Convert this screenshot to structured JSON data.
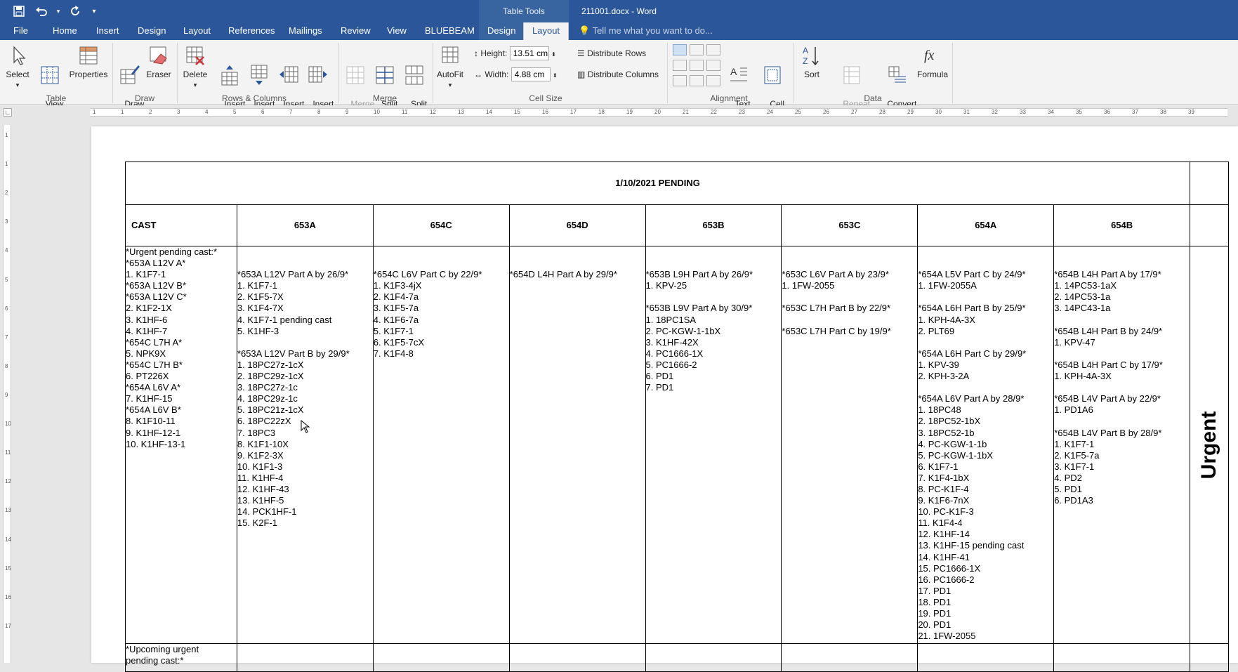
{
  "titlebar": {
    "doc_title": "211001.docx - Word",
    "context_title": "Table Tools",
    "qat": [
      {
        "name": "save-icon",
        "glyph": "💾"
      },
      {
        "name": "undo-icon",
        "glyph": "↶"
      },
      {
        "name": "redo-icon",
        "glyph": "↻"
      },
      {
        "name": "customize-qat-icon",
        "glyph": "▾"
      }
    ]
  },
  "tabs": [
    "File",
    "Home",
    "Insert",
    "Design",
    "Layout",
    "References",
    "Mailings",
    "Review",
    "View",
    "BLUEBEAM",
    "Design",
    "Layout"
  ],
  "tellme": "Tell me what you want to do...",
  "ribbon": {
    "table": {
      "select": "Select",
      "view_gridlines": "View\nGridlines",
      "properties": "Properties",
      "group": "Table"
    },
    "draw": {
      "draw_table": "Draw\nTable",
      "eraser": "Eraser",
      "group": "Draw"
    },
    "rows_columns": {
      "delete": "Delete",
      "insert_above": "Insert\nAbove",
      "insert_below": "Insert\nBelow",
      "insert_left": "Insert\nLeft",
      "insert_right": "Insert\nRight",
      "group": "Rows & Columns"
    },
    "merge": {
      "merge_cells": "Merge\nCells",
      "split_cells": "Split\nCells",
      "split_table": "Split\nTable",
      "group": "Merge"
    },
    "cell_size": {
      "autofit": "AutoFit",
      "height_label": "Height:",
      "height_value": "13.51 cm",
      "width_label": "Width:",
      "width_value": "4.88 cm",
      "distribute_rows": "Distribute Rows",
      "distribute_columns": "Distribute Columns",
      "group": "Cell Size"
    },
    "alignment": {
      "text_direction": "Text\nDirection",
      "cell_margins": "Cell\nMargins",
      "group": "Alignment"
    },
    "data": {
      "sort": "Sort",
      "repeat_header_rows": "Repeat\nHeader Rows",
      "convert_to_text": "Convert\nto Text",
      "formula": "Formula",
      "group": "Data"
    }
  },
  "document": {
    "title": "1/10/2021 PENDING",
    "columns": [
      "CAST",
      "653A",
      "654C",
      "654D",
      "653B",
      "653C",
      "654A",
      "654B"
    ],
    "urgent_label": "Urgent",
    "cells": [
      [
        "*Urgent pending cast:*",
        "*653A L12V A*",
        "1. K1F7-1",
        "*653A L12V B*",
        "*653A L12V C*",
        "2. K1F2-1X",
        "3. K1HF-6",
        "4. K1HF-7",
        "*654C L7H A*",
        "5. NPK9X",
        "*654C L7H B*",
        "6. PT226X",
        "*654A L6V A*",
        "7. K1HF-15",
        "*654A L6V B*",
        "8. K1F10-11",
        "9. K1HF-12-1",
        "10. K1HF-13-1"
      ],
      [
        "",
        "",
        "*653A L12V Part A by 26/9*",
        "1. K1F7-1",
        "2. K1F5-7X",
        "3. K1F4-7X",
        "4. K1F7-1 pending cast",
        "5. K1HF-3",
        "",
        "*653A L12V Part B by 29/9*",
        "1. 18PC27z-1cX",
        "2. 18PC29z-1cX",
        "3. 18PC27z-1c",
        "4. 18PC29z-1c",
        "5. 18PC21z-1cX",
        "6. 18PC22zX",
        "7. 18PC3",
        "8. K1F1-10X",
        "9. K1F2-3X",
        "10. K1F1-3",
        "11. K1HF-4",
        "12. K1HF-43",
        "13. K1HF-5",
        "14. PCK1HF-1",
        "15. K2F-1"
      ],
      [
        "",
        "",
        "*654C L6V Part C by 22/9*",
        "1. K1F3-4jX",
        "2. K1F4-7a",
        "3. K1F5-7a",
        "4. K1F6-7a",
        "5. K1F7-1",
        "6. K1F5-7cX",
        "7. K1F4-8"
      ],
      [
        "",
        "",
        "*654D L4H Part A by 29/9*"
      ],
      [
        "",
        "",
        "*653B L9H Part A by 26/9*",
        "1. KPV-25",
        "",
        "*653B L9V Part A by 30/9*",
        "1. 18PC1SA",
        "2. PC-KGW-1-1bX",
        "3. K1HF-42X",
        "4. PC1666-1X",
        "5. PC1666-2",
        "6. PD1",
        "7. PD1"
      ],
      [
        "",
        "",
        "*653C L6V Part A by 23/9*",
        "1. 1FW-2055",
        "",
        "*653C L7H Part B by 22/9*",
        "",
        "*653C L7H Part C by 19/9*"
      ],
      [
        "",
        "",
        "*654A L5V Part C by 24/9*",
        "1. 1FW-2055A",
        "",
        "*654A L6H Part B by 25/9*",
        "1. KPH-4A-3X",
        "2. PLT69",
        "",
        "*654A L6H Part C by 29/9*",
        "1. KPV-39",
        "2. KPH-3-2A",
        "",
        "*654A L6V Part A by 28/9*",
        "1. 18PC48",
        "2. 18PC52-1bX",
        "3. 18PC52-1b",
        "4. PC-KGW-1-1b",
        "5. PC-KGW-1-1bX",
        "6. K1F7-1",
        "7. K1F4-1bX",
        "8. PC-K1F-4",
        "9. K1F6-7nX",
        "10. PC-K1F-3",
        "11. K1F4-4",
        "12. K1HF-14",
        "13. K1HF-15 pending cast",
        "14. K1HF-41",
        "15. PC1666-1X",
        "16. PC1666-2",
        "17. PD1",
        "18. PD1",
        "19. PD1",
        "20. PD1",
        "21. 1FW-2055"
      ],
      [
        "",
        "",
        "*654B L4H Part A by 17/9*",
        "1. 14PC53-1aX",
        "2. 14PC53-1a",
        "3. 14PC43-1a",
        "",
        "*654B L4H Part B by 24/9*",
        "1. KPV-47",
        "",
        "*654B L4H Part C by 17/9*",
        "1. KPH-4A-3X",
        "",
        "*654B L4V Part A by 22/9*",
        "1. PD1A6",
        "",
        "*654B L4V Part B by 28/9*",
        "1. K1F7-1",
        "2. K1F5-7a",
        "3. K1F7-1",
        "4. PD2",
        "5. PD1",
        "6. PD1A3"
      ]
    ],
    "bottom_row_first": [
      "*Upcoming urgent",
      "pending cast:*"
    ]
  },
  "ruler": {
    "h_labels": [
      "1",
      "1",
      "2",
      "3",
      "4",
      "5",
      "6",
      "7",
      "8",
      "9",
      "10",
      "11",
      "12",
      "13",
      "14",
      "15",
      "16",
      "17",
      "18",
      "19",
      "20",
      "21",
      "22",
      "23",
      "24",
      "25",
      "26",
      "27",
      "28",
      "29",
      "30",
      "31",
      "32",
      "33",
      "34",
      "35",
      "36",
      "37",
      "38",
      "39"
    ],
    "v_labels": [
      "1",
      "1",
      "2",
      "3",
      "4",
      "5",
      "6",
      "7",
      "8",
      "9",
      "10",
      "11",
      "12",
      "13",
      "14",
      "15",
      "16",
      "17"
    ]
  },
  "colors": {
    "accent": "#2b579a",
    "context_tab": "#38649f",
    "ribbon_bg": "#f3f3f3"
  }
}
